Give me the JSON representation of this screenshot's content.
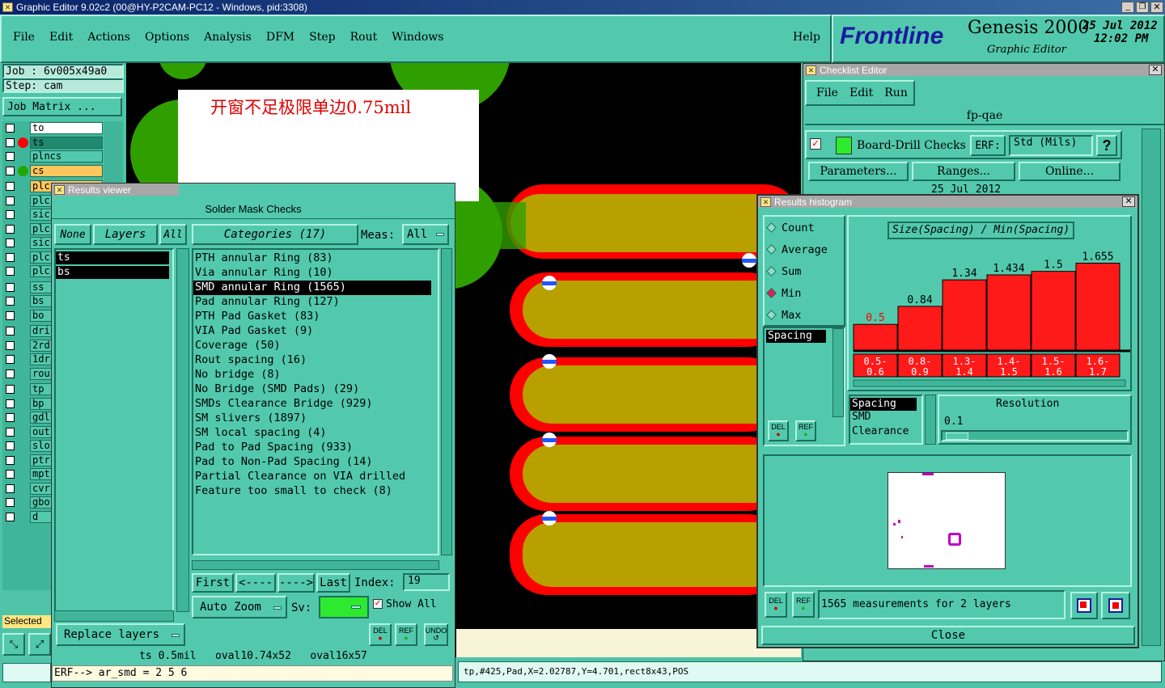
{
  "window": {
    "title": "Graphic Editor 9.02c2 (00@HY-P2CAM-PC12 - Windows, pid:3308)"
  },
  "menu": {
    "items": [
      "File",
      "Edit",
      "Actions",
      "Options",
      "Analysis",
      "DFM",
      "Step",
      "Rout",
      "Windows"
    ],
    "help": "Help"
  },
  "brand": {
    "logo": "Frontline",
    "product": "Genesis 2000",
    "subtitle": "Graphic Editor",
    "date": "25 Jul 2012",
    "time": "12:02 PM"
  },
  "job": {
    "job_label": "Job : 6v005x49a0",
    "step_label": "Step: cam",
    "matrix_button": "Job Matrix ..."
  },
  "layers": [
    "to",
    "ts",
    "plncs",
    "cs",
    "plc",
    "plc",
    "sic",
    "plc",
    "sic",
    "plc",
    "plc",
    "ss",
    "bs",
    "bo",
    "dri",
    "2rd",
    "1dr",
    "rou",
    "tp",
    "bp",
    "gdl",
    "out",
    "slo",
    "ptr",
    "mpt",
    "cvr",
    "gbo",
    "d"
  ],
  "left_status": {
    "selected": "Selected"
  },
  "annotation": {
    "text": "开窗不足极限单边0.75mil"
  },
  "results_viewer": {
    "title": "Results viewer",
    "header": "Solder Mask Checks",
    "none_btn": "None",
    "layers_btn": "Layers",
    "all_btn": "All",
    "layer_list": [
      "ts",
      "bs"
    ],
    "categories_btn": "Categories (17)",
    "meas_label": "Meas:",
    "meas_value": "All",
    "categories": [
      "PTH annular Ring (83)",
      "Via annular Ring (10)",
      "SMD annular Ring (1565)",
      "Pad annular Ring (127)",
      "PTH Pad Gasket (83)",
      "VIA Pad Gasket (9)",
      "Coverage (50)",
      "Rout spacing (16)",
      "No bridge (8)",
      "No Bridge (SMD Pads) (29)",
      "SMDs Clearance Bridge (929)",
      "SM slivers (1897)",
      "SM local spacing (4)",
      "Pad to Pad Spacing (933)",
      "Pad to Non-Pad Spacing (14)",
      "Partial Clearance on VIA drilled",
      "Feature too small to check (8)"
    ],
    "selected_index": 2,
    "first_btn": "First",
    "prev_btn": "<----",
    "next_btn": "---->",
    "last_btn": "Last",
    "index_label": "Index:",
    "index_value": "19",
    "autozoom_btn": "Auto Zoom",
    "sv_label": "Sv:",
    "show_all": "Show All",
    "replace_btn": "Replace layers",
    "del_btn": "DEL",
    "ref_btn": "REF",
    "undo_btn": "UNDO",
    "status": "ts 0.5mil   oval10.74x52   oval16x57"
  },
  "command_line": {
    "text": "ERF--> ar_smd = 2 5 6"
  },
  "status_bar": {
    "text": "tp,#425,Pad,X=2.02787,Y=4.701,rect8x43,POS"
  },
  "checklist_editor": {
    "title": "Checklist Editor",
    "menu": [
      "File",
      "Edit",
      "Run"
    ],
    "name": "fp-qae",
    "action": "Board-Drill Checks",
    "erf_label": "ERF:",
    "erf_value": "Std (Mils)",
    "help_btn": "?",
    "params_btn": "Parameters...",
    "ranges_btn": "Ranges...",
    "online_btn": "Online...",
    "date": "25 Jul 2012"
  },
  "histogram": {
    "title": "Results histogram",
    "modes": [
      "Count",
      "Average",
      "Sum",
      "Min",
      "Max"
    ],
    "selected_mode": "Min",
    "chart_title": "Size(Spacing) / Min(Spacing)",
    "left_list": [
      "Spacing"
    ],
    "bins": [
      "0.5-0.6",
      "0.8-0.9",
      "1.3-1.4",
      "1.4-1.5",
      "1.5-1.6",
      "1.6-1.7"
    ],
    "values": [
      0.5,
      0.84,
      1.34,
      1.434,
      1.5,
      1.655
    ],
    "value_labels": [
      "0.5",
      "0.84",
      "1.34",
      "1.434",
      "1.5",
      "1.655"
    ],
    "bar_color": "#ff1a1a",
    "first_bar_label_color": "#ff0000",
    "list2": [
      "Spacing",
      "SMD",
      "Clearance"
    ],
    "resolution_label": "Resolution",
    "resolution_value": "0.1",
    "measure_text": "1565 measurements for 2 layers",
    "close_btn": "Close",
    "del_btn": "DEL",
    "ref_btn": "REF"
  }
}
